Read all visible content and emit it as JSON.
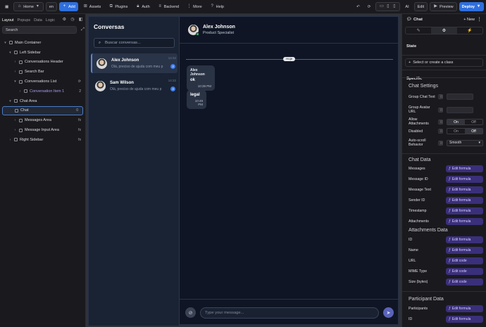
{
  "topbar": {
    "page_label": "Home",
    "lang_label": "en",
    "add_label": "Add",
    "assets_label": "Assets",
    "plugins_label": "Plugins",
    "auth_label": "Auth",
    "backend_label": "Backend",
    "more_label": "More",
    "help_label": "Help",
    "ai_label": "AI",
    "edit_label": "Edit",
    "preview_label": "Preview",
    "deploy_label": "Deploy"
  },
  "left": {
    "tabs": [
      "Layout",
      "Popups",
      "Data",
      "Logic"
    ],
    "search_value": "Search",
    "tree": [
      {
        "label": "Main Container",
        "indent": 0,
        "chev": "▾"
      },
      {
        "label": "Left Sidebar",
        "indent": 1,
        "chev": "▾"
      },
      {
        "label": "Conversations Header",
        "indent": 2,
        "chev": "›"
      },
      {
        "label": "Search Bar",
        "indent": 2,
        "chev": "›"
      },
      {
        "label": "Conversations List",
        "indent": 2,
        "chev": "▾",
        "right": "⟳"
      },
      {
        "label": "Conversation Item 1",
        "indent": 3,
        "chev": "›",
        "right": "2",
        "purple": true
      },
      {
        "label": "Chat Area",
        "indent": 1,
        "chev": "▾"
      },
      {
        "label": "Chat",
        "indent": 1,
        "chev": "",
        "right": "0",
        "selected": true
      },
      {
        "label": "Messages Area",
        "indent": 2,
        "chev": "›",
        "right": "fx"
      },
      {
        "label": "Message Input Area",
        "indent": 2,
        "chev": "›",
        "right": "fx"
      },
      {
        "label": "Right Sidebar",
        "indent": 1,
        "chev": "›",
        "right": "fx"
      }
    ]
  },
  "app": {
    "conv_title": "Conversas",
    "conv_search_placeholder": "Buscar conversas...",
    "conversations": [
      {
        "name": "Alex Johnson",
        "preview": "Olá, preciso de ajuda com meu p",
        "time": "14:32",
        "unread": "3",
        "active": true
      },
      {
        "name": "Sam Wilson",
        "preview": "Olá, preciso de ajuda com meu p",
        "time": "14:32",
        "unread": "3",
        "active": false
      }
    ],
    "chat_name": "Alex Johnson",
    "chat_role": "Product Specialist",
    "date_chip": "Hoje",
    "messages": [
      {
        "who": "Alex Johnson",
        "text": "ok",
        "time": "10:39 PM"
      },
      {
        "who": "",
        "text": "legal",
        "time": "10:49 PM"
      }
    ],
    "input_placeholder": "Type your message..."
  },
  "right": {
    "title": "Chat",
    "new_label": "+ New",
    "state_label": "State",
    "class_label": "Select or create a class",
    "specific_label": "Specific",
    "chat_settings_label": "Chat Settings",
    "settings": [
      {
        "label": "Group Chat Text",
        "kind": "field"
      },
      {
        "label": "Group Avatar URL",
        "kind": "field"
      },
      {
        "label": "Allow Attachments",
        "kind": "toggle",
        "on": "On",
        "off": "Off",
        "value": "On"
      },
      {
        "label": "Disabled",
        "kind": "toggle",
        "on": "On",
        "off": "Off",
        "value": "Off"
      },
      {
        "label": "Auto-scroll Behavior",
        "kind": "select",
        "value": "Smooth"
      }
    ],
    "chat_data_label": "Chat Data",
    "chat_data": [
      {
        "label": "Messages",
        "btn": "Edit formula"
      },
      {
        "label": "Message ID",
        "btn": "Edit formula"
      },
      {
        "label": "Message Text",
        "btn": "Edit formula"
      },
      {
        "label": "Sender ID",
        "btn": "Edit formula"
      },
      {
        "label": "Timestamp",
        "btn": "Edit formula"
      },
      {
        "label": "Attachments",
        "btn": "Edit formula"
      }
    ],
    "attach_data_label": "Attachments Data",
    "attach_data": [
      {
        "label": "ID",
        "btn": "Edit formula"
      },
      {
        "label": "Name",
        "btn": "Edit formula"
      },
      {
        "label": "URL",
        "btn": "Edit code"
      },
      {
        "label": "MIME Type",
        "btn": "Edit code"
      },
      {
        "label": "Size (bytes)",
        "btn": "Edit code"
      }
    ],
    "participant_data_label": "Participant Data",
    "participant_data": [
      {
        "label": "Participants",
        "btn": "Edit formula"
      },
      {
        "label": "ID",
        "btn": "Edit formula"
      }
    ]
  }
}
